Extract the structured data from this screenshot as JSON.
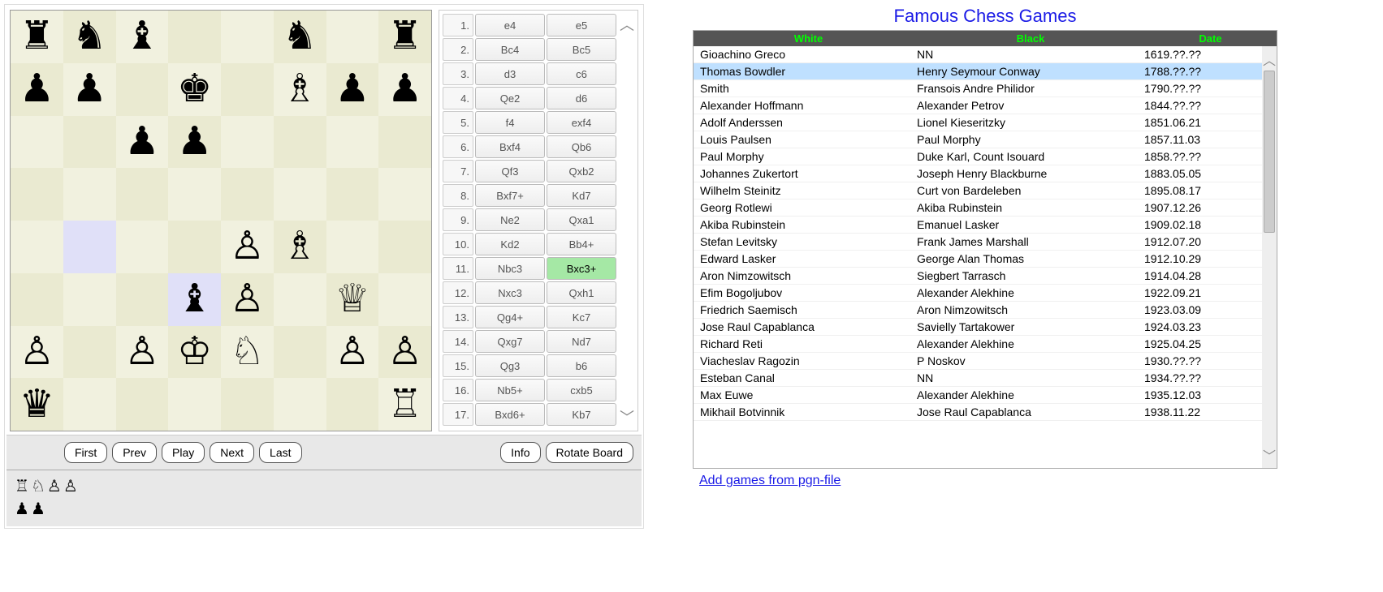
{
  "board": {
    "squares": [
      [
        "r",
        "n",
        "b",
        "",
        "",
        "n",
        "",
        "r"
      ],
      [
        "p",
        "p",
        "",
        "k",
        "",
        "B",
        "p",
        "p"
      ],
      [
        "",
        "",
        "p",
        "p",
        "",
        "",
        "",
        ""
      ],
      [
        "",
        "",
        "",
        "",
        "",
        "",
        "",
        ""
      ],
      [
        "",
        "",
        "",
        "",
        "P",
        "B",
        "",
        ""
      ],
      [
        "",
        "",
        "",
        "b",
        "P",
        "",
        "Q",
        ""
      ],
      [
        "P",
        "",
        "P",
        "K",
        "N",
        "",
        "P",
        "P"
      ],
      [
        "q",
        "",
        "",
        "",
        "",
        "",
        "",
        "R"
      ]
    ],
    "highlights": [
      [
        4,
        1
      ],
      [
        5,
        3
      ]
    ]
  },
  "moves": [
    {
      "n": "1.",
      "w": "e4",
      "b": "e5"
    },
    {
      "n": "2.",
      "w": "Bc4",
      "b": "Bc5"
    },
    {
      "n": "3.",
      "w": "d3",
      "b": "c6"
    },
    {
      "n": "4.",
      "w": "Qe2",
      "b": "d6"
    },
    {
      "n": "5.",
      "w": "f4",
      "b": "exf4"
    },
    {
      "n": "6.",
      "w": "Bxf4",
      "b": "Qb6"
    },
    {
      "n": "7.",
      "w": "Qf3",
      "b": "Qxb2"
    },
    {
      "n": "8.",
      "w": "Bxf7+",
      "b": "Kd7"
    },
    {
      "n": "9.",
      "w": "Ne2",
      "b": "Qxa1"
    },
    {
      "n": "10.",
      "w": "Kd2",
      "b": "Bb4+"
    },
    {
      "n": "11.",
      "w": "Nbc3",
      "b": "Bxc3+",
      "current": "b"
    },
    {
      "n": "12.",
      "w": "Nxc3",
      "b": "Qxh1"
    },
    {
      "n": "13.",
      "w": "Qg4+",
      "b": "Kc7"
    },
    {
      "n": "14.",
      "w": "Qxg7",
      "b": "Nd7"
    },
    {
      "n": "15.",
      "w": "Qg3",
      "b": "b6"
    },
    {
      "n": "16.",
      "w": "Nb5+",
      "b": "cxb5"
    },
    {
      "n": "17.",
      "w": "Bxd6+",
      "b": "Kb7"
    }
  ],
  "controls": {
    "first": "First",
    "prev": "Prev",
    "play": "Play",
    "next": "Next",
    "last": "Last",
    "info": "Info",
    "rotate": "Rotate Board"
  },
  "captured": {
    "white": [
      "♖",
      "♘",
      "♙",
      "♙"
    ],
    "black": [
      "♟",
      "♟"
    ]
  },
  "games": {
    "title": "Famous Chess Games",
    "headers": {
      "white": "White",
      "black": "Black",
      "date": "Date"
    },
    "selected": 1,
    "rows": [
      {
        "w": "Gioachino Greco",
        "b": "NN",
        "d": "1619.??.??"
      },
      {
        "w": "Thomas Bowdler",
        "b": "Henry Seymour Conway",
        "d": "1788.??.??"
      },
      {
        "w": "Smith",
        "b": "Fransois Andre Philidor",
        "d": "1790.??.??"
      },
      {
        "w": "Alexander Hoffmann",
        "b": "Alexander Petrov",
        "d": "1844.??.??"
      },
      {
        "w": "Adolf Anderssen",
        "b": "Lionel Kieseritzky",
        "d": "1851.06.21"
      },
      {
        "w": "Louis Paulsen",
        "b": "Paul Morphy",
        "d": "1857.11.03"
      },
      {
        "w": "Paul Morphy",
        "b": "Duke Karl, Count Isouard",
        "d": "1858.??.??"
      },
      {
        "w": "Johannes Zukertort",
        "b": "Joseph Henry Blackburne",
        "d": "1883.05.05"
      },
      {
        "w": "Wilhelm Steinitz",
        "b": "Curt von Bardeleben",
        "d": "1895.08.17"
      },
      {
        "w": "Georg Rotlewi",
        "b": "Akiba Rubinstein",
        "d": "1907.12.26"
      },
      {
        "w": "Akiba Rubinstein",
        "b": "Emanuel Lasker",
        "d": "1909.02.18"
      },
      {
        "w": "Stefan Levitsky",
        "b": "Frank James Marshall",
        "d": "1912.07.20"
      },
      {
        "w": "Edward Lasker",
        "b": "George Alan Thomas",
        "d": "1912.10.29"
      },
      {
        "w": "Aron Nimzowitsch",
        "b": "Siegbert Tarrasch",
        "d": "1914.04.28"
      },
      {
        "w": "Efim Bogoljubov",
        "b": "Alexander Alekhine",
        "d": "1922.09.21"
      },
      {
        "w": "Friedrich Saemisch",
        "b": "Aron Nimzowitsch",
        "d": "1923.03.09"
      },
      {
        "w": "Jose Raul Capablanca",
        "b": "Savielly Tartakower",
        "d": "1924.03.23"
      },
      {
        "w": "Richard Reti",
        "b": "Alexander Alekhine",
        "d": "1925.04.25"
      },
      {
        "w": "Viacheslav Ragozin",
        "b": "P Noskov",
        "d": "1930.??.??"
      },
      {
        "w": "Esteban Canal",
        "b": "NN",
        "d": "1934.??.??"
      },
      {
        "w": "Max Euwe",
        "b": "Alexander Alekhine",
        "d": "1935.12.03"
      },
      {
        "w": "Mikhail Botvinnik",
        "b": "Jose Raul Capablanca",
        "d": "1938.11.22"
      }
    ],
    "add_link": "Add games from pgn-file"
  }
}
